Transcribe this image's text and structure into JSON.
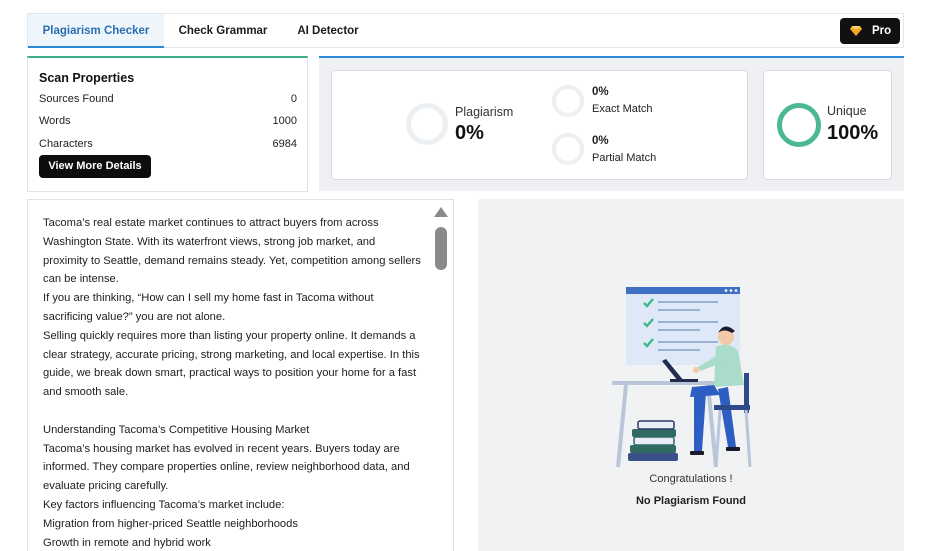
{
  "tabs": [
    {
      "label": "Plagiarism Checker",
      "active": true
    },
    {
      "label": "Check Grammar",
      "active": false
    },
    {
      "label": "AI Detector",
      "active": false
    }
  ],
  "pro": {
    "label": "Pro",
    "icon": "gem-icon"
  },
  "scan": {
    "title": "Scan Properties",
    "rows": [
      {
        "label": "Sources Found",
        "value": "0"
      },
      {
        "label": "Words",
        "value": "1000"
      },
      {
        "label": "Characters",
        "value": "6984"
      }
    ],
    "button": "View More Details"
  },
  "results": {
    "plagiarism": {
      "label": "Plagiarism",
      "value": "0%"
    },
    "exact": {
      "value": "0%",
      "label": "Exact Match"
    },
    "partial": {
      "value": "0%",
      "label": "Partial Match"
    },
    "unique": {
      "label": "Unique",
      "value": "100%"
    }
  },
  "colors": {
    "accent": "#2a86d6",
    "unique_ring": "#4cb893",
    "button_dark": "#0d0d0d"
  },
  "text": {
    "paragraphs": [
      "Tacoma’s real estate market continues to attract buyers from across Washington State. With its waterfront views, strong job market, and proximity to Seattle, demand remains steady. Yet, competition among sellers can be intense.",
      "If you are thinking, “How can I sell my home fast in Tacoma without sacrificing value?” you are not alone.",
      "Selling quickly requires more than listing your property online. It demands a clear strategy, accurate pricing, strong marketing, and local expertise. In this guide, we break down smart, practical ways to position your home for a fast and smooth sale.",
      "",
      "Understanding Tacoma’s Competitive Housing Market",
      "Tacoma’s housing market has evolved in recent years. Buyers today are informed. They compare properties online, review neighborhood data, and evaluate pricing carefully.",
      "Key factors influencing Tacoma’s market include:",
      "Migration from higher-priced Seattle neighborhoods",
      "Growth in remote and hybrid work"
    ]
  },
  "congrats": {
    "line1": "Congratulations !",
    "line2": "No Plagiarism Found"
  }
}
